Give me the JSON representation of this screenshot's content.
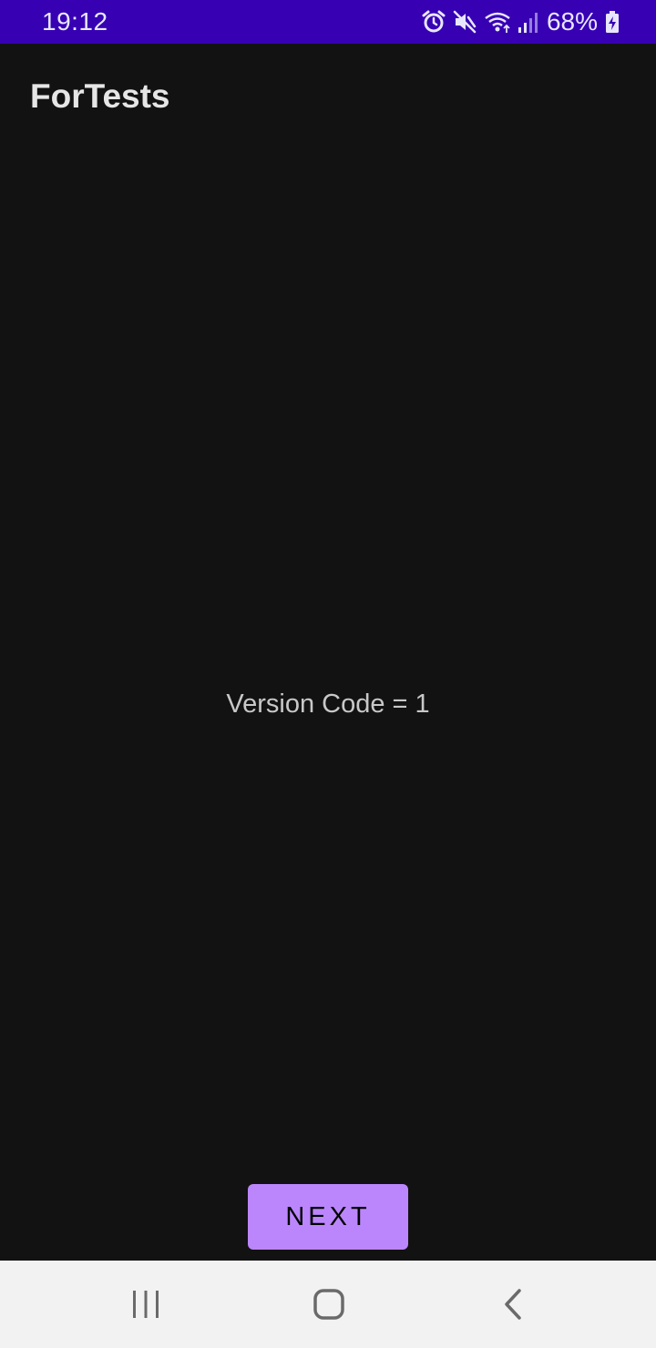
{
  "status_bar": {
    "time": "19:12",
    "battery_percent": "68%",
    "icons": [
      "alarm-icon",
      "mute-icon",
      "wifi-icon",
      "signal-icon",
      "battery-charging-icon"
    ],
    "background_color": "#3700b3"
  },
  "app_bar": {
    "title": "ForTests"
  },
  "main": {
    "version_text": "Version Code = 1"
  },
  "actions": {
    "next_label": "NEXT",
    "accent_color": "#bb86fc"
  },
  "nav_bar": {
    "buttons": [
      "recents-icon",
      "home-icon",
      "back-icon"
    ]
  }
}
